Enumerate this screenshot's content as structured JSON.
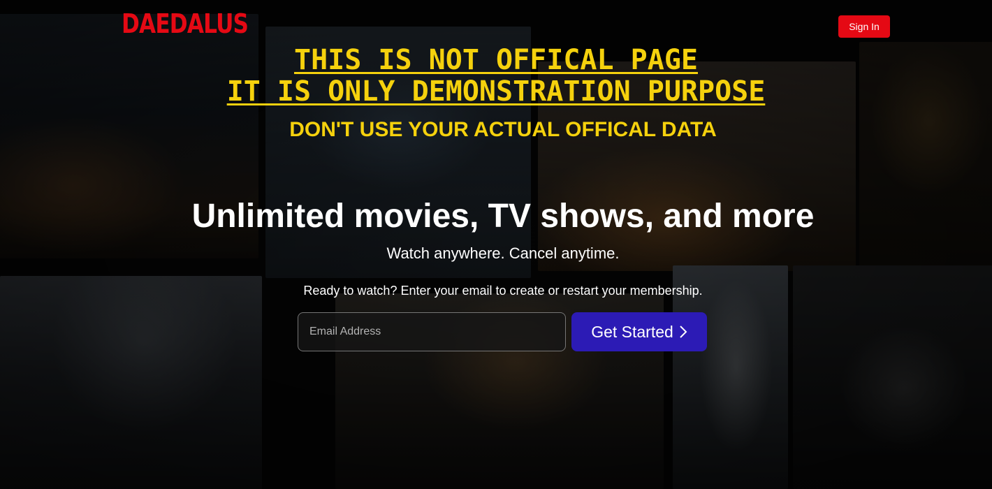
{
  "brand": {
    "logo": "DAEDALUS",
    "color": "#e50914"
  },
  "header": {
    "sign_in_label": "Sign In"
  },
  "warning": {
    "line1": "THIS IS NOT OFFICAL PAGE",
    "line2": "IT IS ONLY DEMONSTRATION PURPOSE",
    "line3": "DON'T USE YOUR ACTUAL OFFICAL DATA",
    "color": "#f5d10d"
  },
  "hero": {
    "headline": "Unlimited movies, TV shows, and more",
    "subline": "Watch anywhere. Cancel anytime.",
    "prompt": "Ready to watch? Enter your email to create or restart your membership."
  },
  "form": {
    "email_placeholder": "Email Address",
    "email_value": "",
    "cta_label": "Get Started",
    "cta_icon": "chevron-right-icon",
    "cta_color": "#2c1bb5"
  }
}
